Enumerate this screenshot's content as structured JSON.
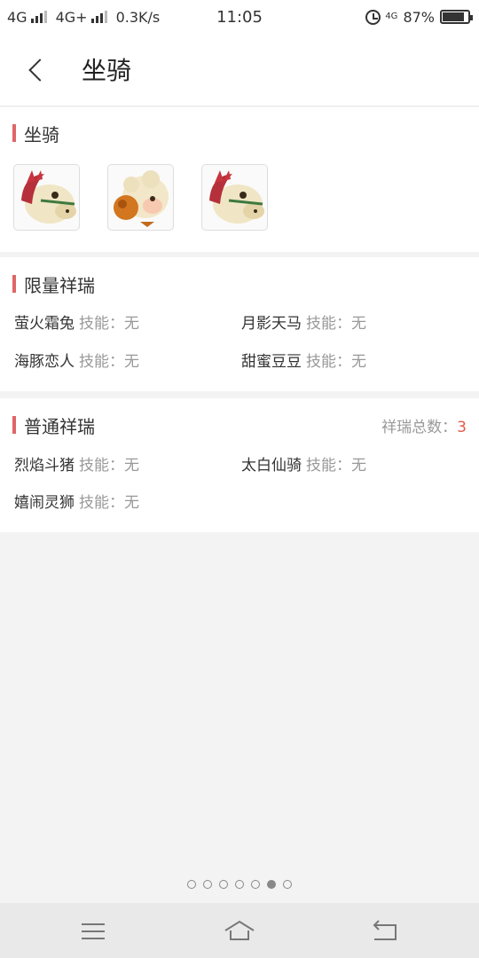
{
  "status": {
    "network1": "4G",
    "network2": "4G+",
    "speed": "0.3K/s",
    "time": "11:05",
    "volte": "4G",
    "battery_text": "87%",
    "battery_level": 0.87
  },
  "header": {
    "title": "坐骑"
  },
  "mounts": {
    "title": "坐骑",
    "items": [
      {
        "icon": "horse-mount-icon"
      },
      {
        "icon": "sheep-mount-icon"
      },
      {
        "icon": "horse-mount-icon"
      }
    ]
  },
  "limited": {
    "title": "限量祥瑞",
    "items": [
      {
        "name": "萤火霜兔",
        "skill": "技能：无"
      },
      {
        "name": "月影天马",
        "skill": "技能：无"
      },
      {
        "name": "海豚恋人",
        "skill": "技能：无"
      },
      {
        "name": "甜蜜豆豆",
        "skill": "技能：无"
      }
    ]
  },
  "normal": {
    "title": "普通祥瑞",
    "total_label": "祥瑞总数：",
    "total_value": "3",
    "items": [
      {
        "name": "烈焰斗猪",
        "skill": "技能：无"
      },
      {
        "name": "太白仙骑",
        "skill": "技能：无"
      },
      {
        "name": "嬉闹灵狮",
        "skill": "技能：无"
      }
    ]
  },
  "pager": {
    "count": 7,
    "active": 6
  },
  "colors": {
    "accent": "#e06666",
    "total_number": "#e35b4a"
  }
}
